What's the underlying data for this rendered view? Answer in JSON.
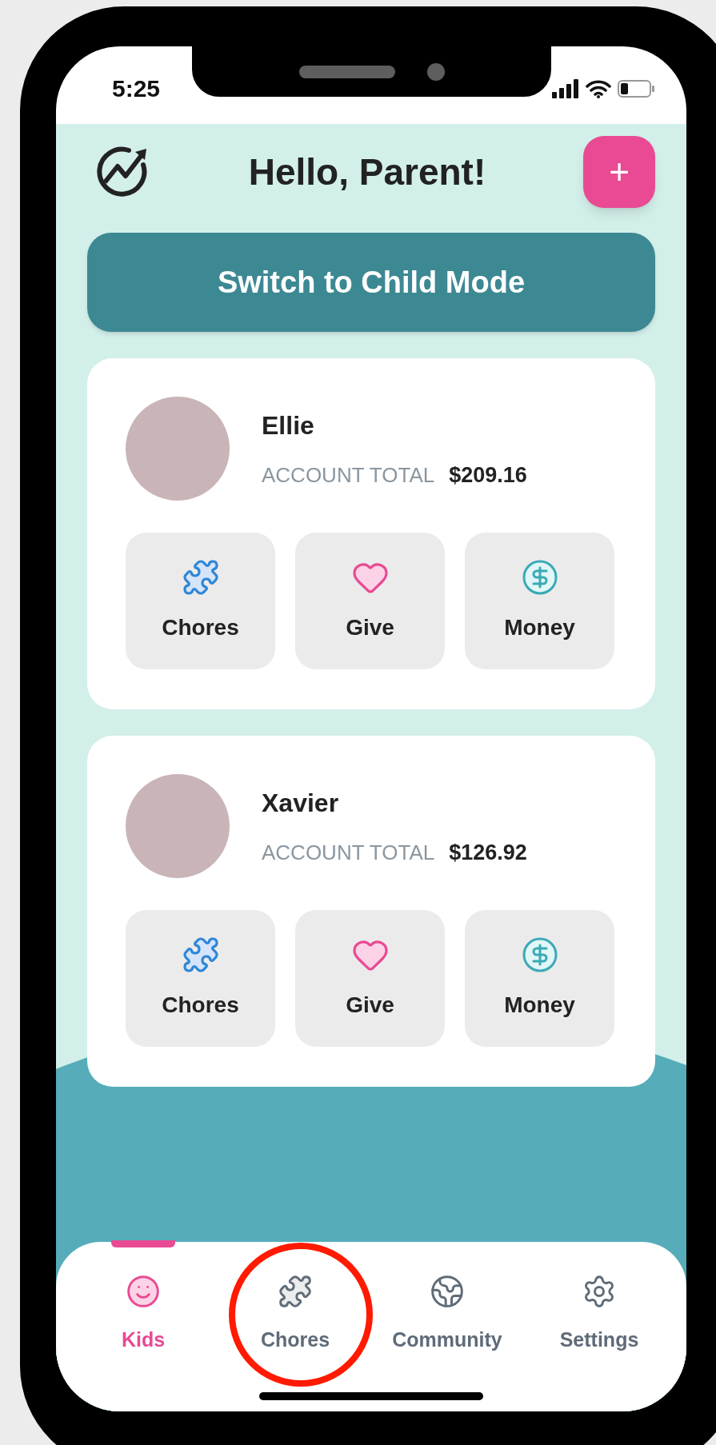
{
  "status_bar": {
    "time": "5:25"
  },
  "header": {
    "title": "Hello, Parent!",
    "add_button": "+"
  },
  "mode_button": "Switch to Child Mode",
  "kids": [
    {
      "name": "Ellie",
      "total_label": "ACCOUNT TOTAL",
      "total": "$209.16",
      "actions": [
        {
          "kind": "chores",
          "label": "Chores"
        },
        {
          "kind": "give",
          "label": "Give"
        },
        {
          "kind": "money",
          "label": "Money"
        }
      ]
    },
    {
      "name": "Xavier",
      "total_label": "ACCOUNT TOTAL",
      "total": "$126.92",
      "actions": [
        {
          "kind": "chores",
          "label": "Chores"
        },
        {
          "kind": "give",
          "label": "Give"
        },
        {
          "kind": "money",
          "label": "Money"
        }
      ]
    }
  ],
  "nav": [
    {
      "kind": "kids",
      "label": "Kids",
      "selected": true
    },
    {
      "kind": "chores",
      "label": "Chores",
      "selected": false
    },
    {
      "kind": "community",
      "label": "Community",
      "selected": false
    },
    {
      "kind": "settings",
      "label": "Settings",
      "selected": false
    }
  ]
}
